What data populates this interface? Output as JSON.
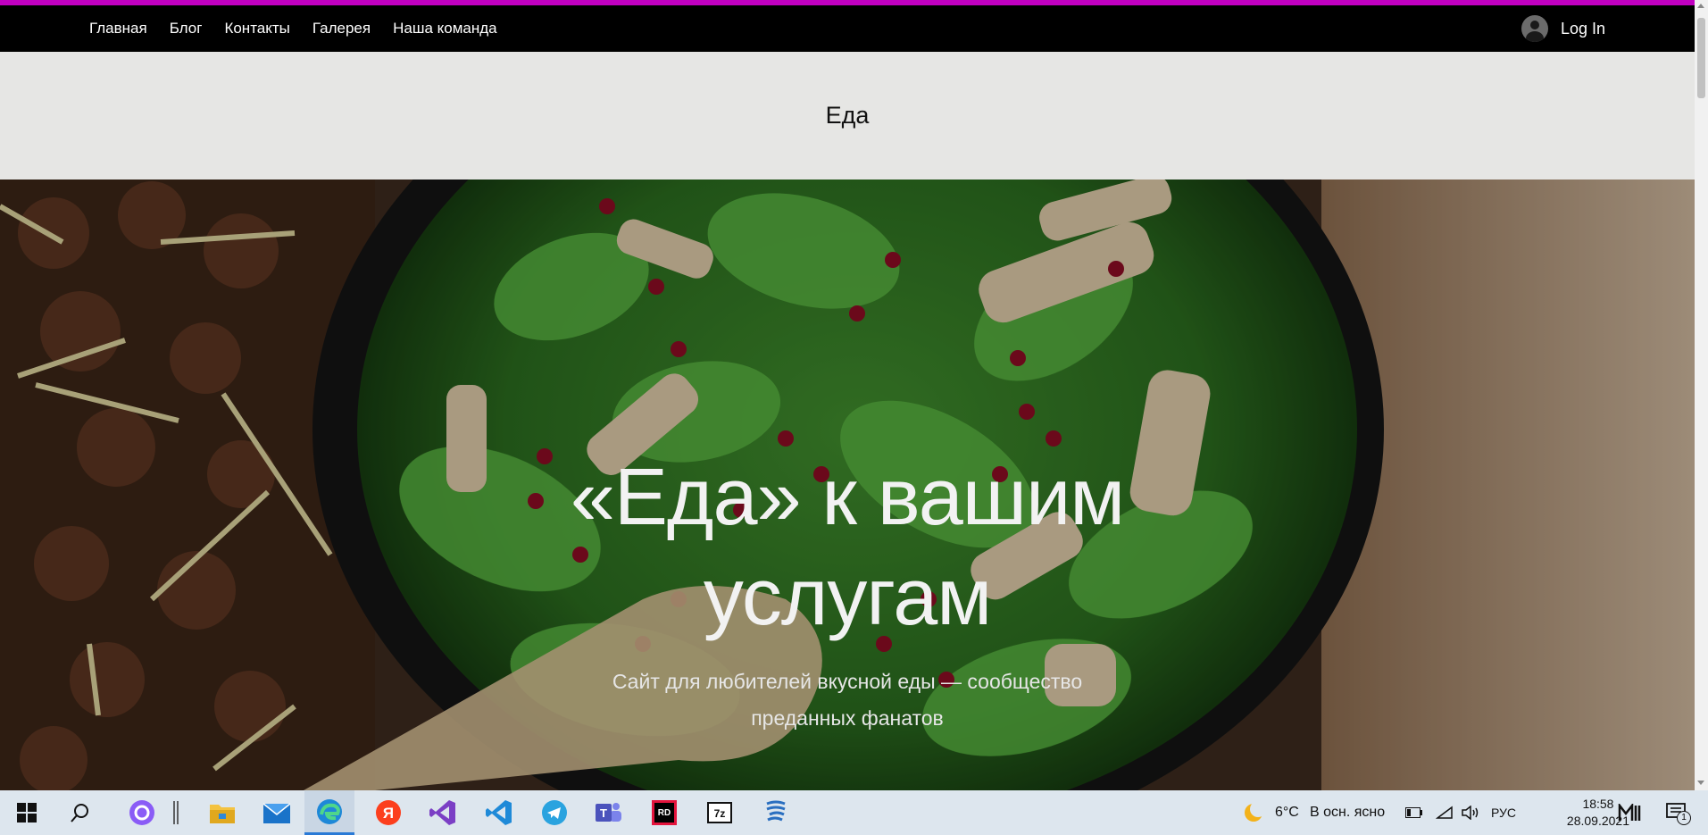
{
  "nav": {
    "links": [
      "Главная",
      "Блог",
      "Контакты",
      "Галерея",
      "Наша команда"
    ],
    "login_label": "Log In"
  },
  "site": {
    "title": "Еда"
  },
  "hero": {
    "title": "«Еда» к вашим услугам",
    "subtitle": "Сайт для любителей вкусной еды — сообщество преданных фанатов"
  },
  "taskbar": {
    "weather_temp": "6°C",
    "weather_desc": "В осн. ясно",
    "language": "РУС",
    "time": "18:58",
    "date": "28.09.2021",
    "notification_count": "1",
    "apps": [
      "windows-start",
      "search",
      "alice",
      "file-explorer",
      "mail",
      "edge",
      "yandex-browser",
      "visual-studio",
      "vscode",
      "telegram",
      "teams",
      "rider",
      "7zip",
      "other-app"
    ]
  },
  "colors": {
    "accent_line": "#c100c1",
    "navbar": "#000000",
    "band": "#e6e6e4",
    "taskbar": "#dde6ee"
  }
}
